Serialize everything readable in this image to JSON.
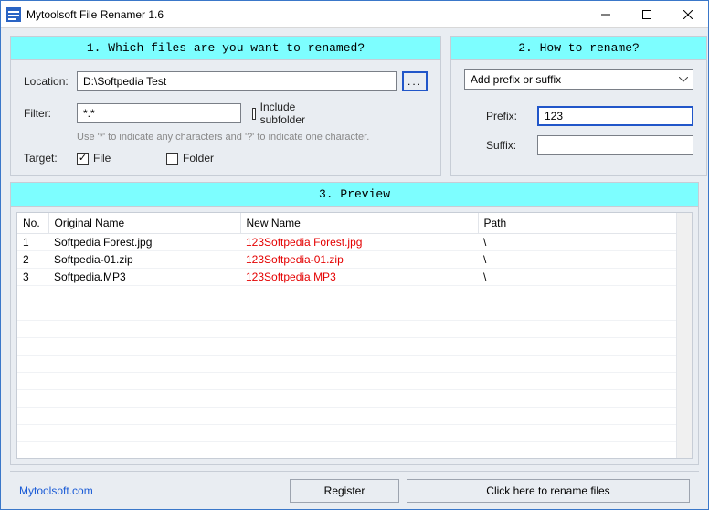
{
  "window": {
    "title": "Mytoolsoft File Renamer 1.6"
  },
  "section1": {
    "header": "1. Which files are you want to renamed?",
    "location_label": "Location:",
    "location_value": "D:\\Softpedia Test",
    "browse_label": "...",
    "filter_label": "Filter:",
    "filter_value": "*.*",
    "include_subfolder_label": "Include subfolder",
    "hint": "Use '*' to indicate any characters and '?' to indicate one character.",
    "target_label": "Target:",
    "file_label": "File",
    "folder_label": "Folder"
  },
  "section2": {
    "header": "2. How to rename?",
    "mode_selected": "Add prefix or suffix",
    "prefix_label": "Prefix:",
    "prefix_value": "123",
    "suffix_label": "Suffix:",
    "suffix_value": ""
  },
  "section3": {
    "header": "3. Preview",
    "columns": {
      "no": "No.",
      "orig": "Original Name",
      "newn": "New Name",
      "path": "Path"
    },
    "rows": [
      {
        "no": "1",
        "orig": "Softpedia Forest.jpg",
        "newn": "123Softpedia Forest.jpg",
        "path": "\\"
      },
      {
        "no": "2",
        "orig": "Softpedia-01.zip",
        "newn": "123Softpedia-01.zip",
        "path": "\\"
      },
      {
        "no": "3",
        "orig": "Softpedia.MP3",
        "newn": "123Softpedia.MP3",
        "path": "\\"
      }
    ]
  },
  "footer": {
    "link": "Mytoolsoft.com",
    "register": "Register",
    "rename": "Click here to rename files"
  }
}
